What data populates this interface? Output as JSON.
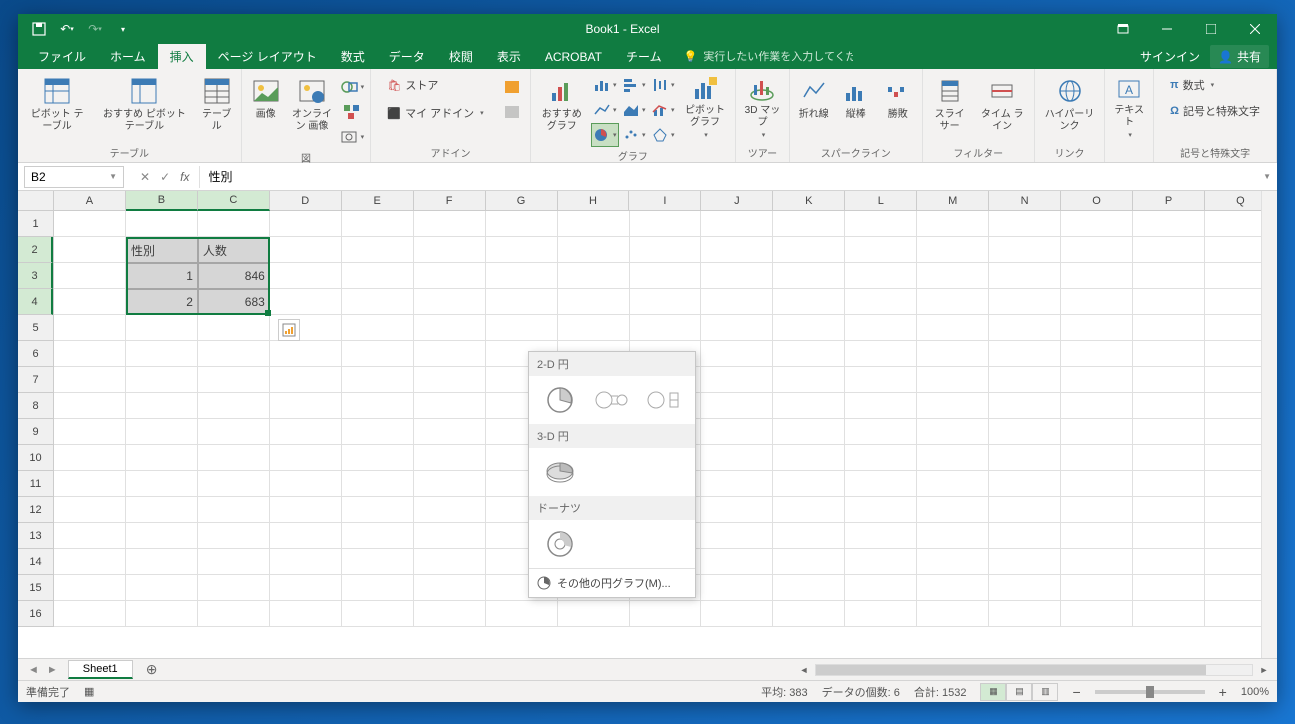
{
  "title": "Book1 - Excel",
  "tabs": {
    "file": "ファイル",
    "home": "ホーム",
    "insert": "挿入",
    "page_layout": "ページ レイアウト",
    "formulas": "数式",
    "data": "データ",
    "review": "校閲",
    "view": "表示",
    "acrobat": "ACROBAT",
    "team": "チーム"
  },
  "tell_me_placeholder": "実行したい作業を入力してください...",
  "signin": "サインイン",
  "share": "共有",
  "ribbon": {
    "pivot_table": "ピボット\nテーブル",
    "rec_pivot": "おすすめ\nピボットテーブル",
    "table": "テーブル",
    "tables_group": "テーブル",
    "picture": "画像",
    "online_pic": "オンライン\n画像",
    "illustrations_group": "図",
    "store": "ストア",
    "my_addins": "マイ アドイン",
    "addins_group": "アドイン",
    "rec_chart": "おすすめ\nグラフ",
    "pivot_chart": "ピボットグラフ",
    "charts_group": "グラフ",
    "map3d": "3D マッ\nプ",
    "tour_group": "ツアー",
    "sparkline_line": "折れ線",
    "sparkline_col": "縦棒",
    "sparkline_wl": "勝敗",
    "sparklines_group": "スパークライン",
    "slicer": "スライサー",
    "timeline": "タイム\nライン",
    "filter_group": "フィルター",
    "hyperlink": "ハイパーリンク",
    "link_group": "リンク",
    "textbox": "テキスト",
    "equation": "数式",
    "symbol": "記号と特殊文字",
    "symbols_group": "記号と特殊文字"
  },
  "name_box": "B2",
  "formula_value": "性別",
  "columns": [
    "A",
    "B",
    "C",
    "D",
    "E",
    "F",
    "G",
    "H",
    "I",
    "J",
    "K",
    "L",
    "M",
    "N",
    "O",
    "P",
    "Q"
  ],
  "row_count": 16,
  "table_data": {
    "headers": {
      "col1": "性別",
      "col2": "人数"
    },
    "rows": [
      {
        "col1": "1",
        "col2": "846"
      },
      {
        "col1": "2",
        "col2": "683"
      }
    ]
  },
  "pie_menu": {
    "hdr_2d": "2-D 円",
    "hdr_3d": "3-D 円",
    "hdr_donut": "ドーナツ",
    "more": "その他の円グラフ(M)..."
  },
  "sheet_tab": "Sheet1",
  "status": {
    "ready": "準備完了",
    "avg_label": "平均:",
    "avg": "383",
    "count_label": "データの個数:",
    "count": "6",
    "sum_label": "合計:",
    "sum": "1532",
    "zoom": "100%"
  }
}
